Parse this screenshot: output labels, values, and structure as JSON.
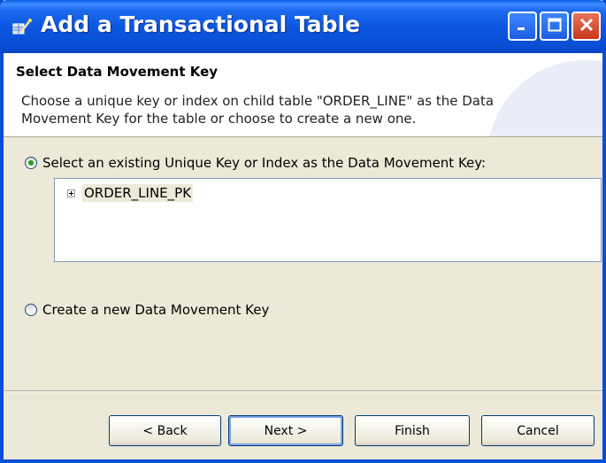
{
  "window": {
    "title": "Add a Transactional Table"
  },
  "header": {
    "title": "Select Data Movement Key",
    "description": "Choose a unique key or index on child table \"ORDER_LINE\" as the Data Movement Key for the table or choose to create a new one."
  },
  "options": {
    "existing_label": "Select an existing Unique Key or Index as the Data Movement Key:",
    "existing_selected": true,
    "create_label": "Create a new Data Movement Key",
    "create_selected": false
  },
  "keys": [
    {
      "name": "ORDER_LINE_PK",
      "expandable": true
    }
  ],
  "buttons": {
    "back": "< Back",
    "next": "Next >",
    "finish": "Finish",
    "cancel": "Cancel"
  },
  "icons": {
    "title": "wizard-app-icon",
    "minimize": "minimize-icon",
    "maximize": "maximize-icon",
    "close": "close-icon",
    "expand": "plus-expander-icon"
  },
  "colors": {
    "titlebar": "#0a4fd6",
    "close_button": "#c7361a",
    "dialog_face": "#ece9d8",
    "radio_dot": "#21a121"
  }
}
